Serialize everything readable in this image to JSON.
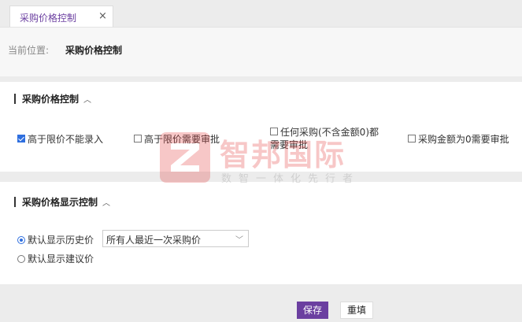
{
  "tab": {
    "label": "采购价格控制",
    "close": "×"
  },
  "location": {
    "prefix": "当前位置:",
    "path": "采购价格控制"
  },
  "section1": {
    "title": "采购价格控制",
    "options": [
      {
        "label": "高于限价不能录入",
        "checked": true
      },
      {
        "label": "高于限价需要审批",
        "checked": false
      },
      {
        "label_line1": "任何采购(不含金额0)都",
        "label_line2": "需要审批",
        "checked": false
      },
      {
        "label": "采购金额为0需要审批",
        "checked": false
      }
    ]
  },
  "section2": {
    "title": "采购价格显示控制",
    "radios": [
      {
        "label": "默认显示历史价",
        "checked": true
      },
      {
        "label": "默认显示建议价",
        "checked": false
      }
    ],
    "select_value": "所有人最近一次采购价"
  },
  "buttons": {
    "save": "保存",
    "reset": "重填"
  },
  "watermark": {
    "name": "智邦国际",
    "slogan": "数智一体化先行者"
  },
  "colors": {
    "accent": "#6b3fa0",
    "check": "#2f6fdf"
  }
}
